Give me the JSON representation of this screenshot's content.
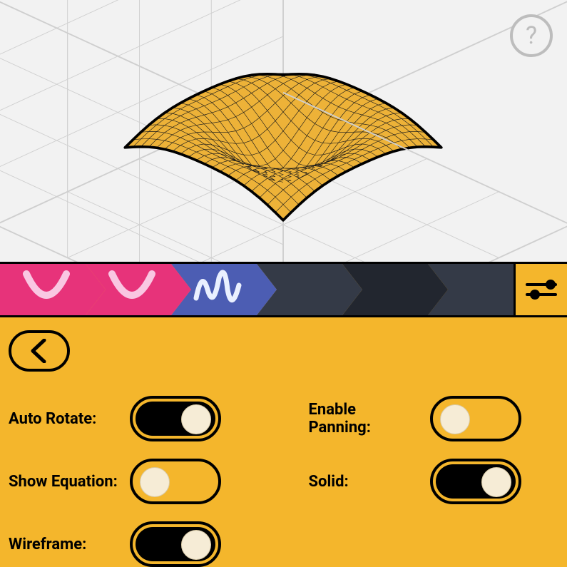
{
  "help": {
    "tooltip": "?"
  },
  "steps": {
    "items": [
      {
        "name": "step-1",
        "state": "completed",
        "icon": "parabola-icon"
      },
      {
        "name": "step-2",
        "state": "completed",
        "icon": "parabola-icon"
      },
      {
        "name": "step-3",
        "state": "active",
        "icon": "sinewave-icon"
      }
    ],
    "settings_button": "equalizer-icon"
  },
  "colors": {
    "accent": "#f4b62c",
    "step_completed": "#e7337a",
    "step_active": "#4c5db3",
    "step_dark": "#22262f",
    "step_dark2": "#343a47",
    "viewport_bg": "#f2f2f2",
    "grid": "#cfcfcf",
    "panel_text": "#000"
  },
  "panel": {
    "back_label": "Back",
    "toggles": {
      "auto_rotate": {
        "label": "Auto Rotate:",
        "on": true
      },
      "enable_panning": {
        "label": "Enable Panning:",
        "on": false
      },
      "show_equation": {
        "label": "Show Equation:",
        "on": false
      },
      "solid": {
        "label": "Solid:",
        "on": true
      },
      "wireframe": {
        "label": "Wireframe:",
        "on": true
      }
    }
  },
  "surface": {
    "description": "3D surface plot with wireframe, radial ripple, rendered solid yellow",
    "equation_visible": false
  }
}
